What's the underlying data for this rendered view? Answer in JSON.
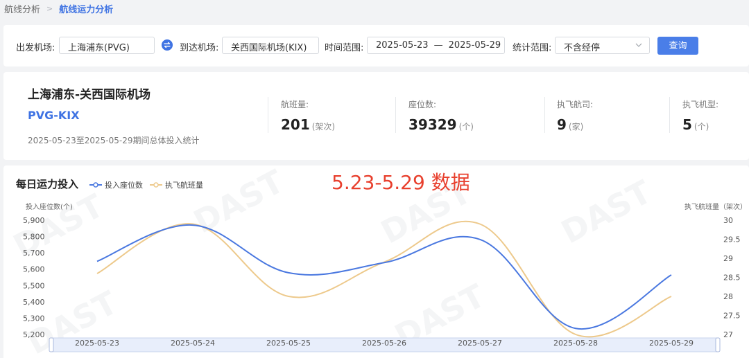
{
  "breadcrumb": {
    "parent": "航线分析",
    "current": "航线运力分析"
  },
  "filters": {
    "departure_label": "出发机场:",
    "departure_value": "上海浦东(PVG)",
    "arrival_label": "到达机场:",
    "arrival_value": "关西国际机场(KIX)",
    "time_label": "时间范围:",
    "date_start": "2025-05-23",
    "date_sep": "—",
    "date_end": "2025-05-29",
    "scope_label": "统计范围:",
    "scope_value": "不含经停",
    "query_button": "查询"
  },
  "summary": {
    "route_name": "上海浦东-关西国际机场",
    "route_code": "PVG-KIX",
    "period_text": "2025-05-23至2025-05-29期间总体投入统计",
    "stats": [
      {
        "label": "航班量:",
        "value": "201",
        "unit": "(架次)"
      },
      {
        "label": "座位数:",
        "value": "39329",
        "unit": "(个)"
      },
      {
        "label": "执飞航司:",
        "value": "9",
        "unit": "(家)"
      },
      {
        "label": "执飞机型:",
        "value": "5",
        "unit": "(个)"
      }
    ]
  },
  "chart_section": {
    "title": "每日运力投入",
    "overlay_note": "5.23-5.29 数据",
    "watermark": "DAST"
  },
  "colors": {
    "accent": "#3f73e3",
    "series_seats": "#4a78e0",
    "series_flights": "#edc98b",
    "note": "#e8402e"
  },
  "chart_data": {
    "type": "line",
    "x": [
      "2025-05-23",
      "2025-05-24",
      "2025-05-25",
      "2025-05-26",
      "2025-05-27",
      "2025-05-28",
      "2025-05-29"
    ],
    "ylabel": "投入座位数(个)",
    "y2label": "执飞航班量（架次）",
    "ylim": [
      5200,
      5900
    ],
    "yticks": [
      "5,900",
      "5,800",
      "5,700",
      "5,600",
      "5,500",
      "5,400",
      "5,300",
      "5,200"
    ],
    "y2lim": [
      27,
      30
    ],
    "y2ticks": [
      "30",
      "29.5",
      "29",
      "28.5",
      "28",
      "27.5",
      "27"
    ],
    "series": [
      {
        "name": "投入座位数",
        "axis": "left",
        "values": [
          5648,
          5870,
          5578,
          5640,
          5782,
          5237,
          5565
        ]
      },
      {
        "name": "执飞航班量",
        "axis": "right",
        "values": [
          28.6,
          29.9,
          28,
          28.9,
          29.9,
          27,
          28
        ]
      }
    ],
    "legend": "top-left",
    "grid": false
  }
}
